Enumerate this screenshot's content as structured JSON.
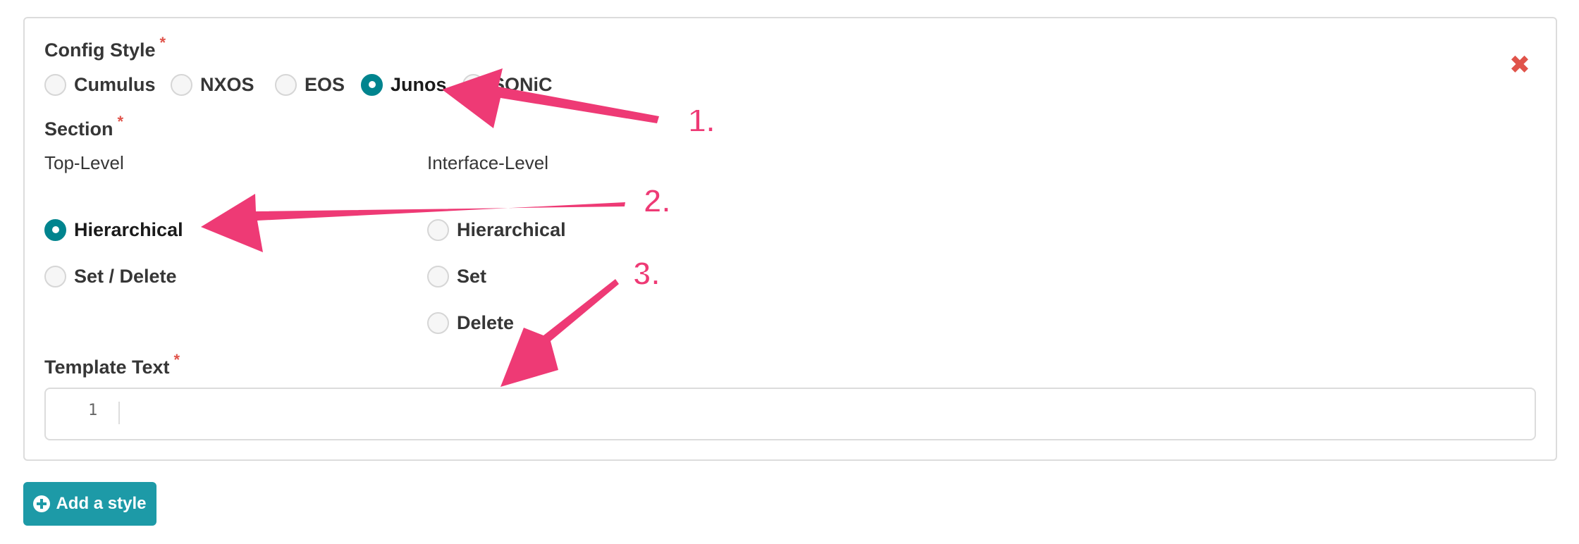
{
  "config_style": {
    "label": "Config Style",
    "required_mark": "*",
    "options": [
      {
        "label": "Cumulus",
        "checked": false
      },
      {
        "label": "NXOS",
        "checked": false
      },
      {
        "label": "EOS",
        "checked": false
      },
      {
        "label": "Junos",
        "checked": true
      },
      {
        "label": "SONiC",
        "checked": false
      }
    ]
  },
  "section": {
    "label": "Section",
    "required_mark": "*",
    "top_level": {
      "label": "Top-Level",
      "options": [
        {
          "label": "Hierarchical",
          "checked": true
        },
        {
          "label": "Set / Delete",
          "checked": false
        }
      ]
    },
    "interface_level": {
      "label": "Interface-Level",
      "options": [
        {
          "label": "Hierarchical",
          "checked": false
        },
        {
          "label": "Set",
          "checked": false
        },
        {
          "label": "Delete",
          "checked": false
        }
      ]
    }
  },
  "template_text": {
    "label": "Template Text",
    "required_mark": "*",
    "line_number": "1",
    "value": ""
  },
  "close_icon": "close-icon",
  "add_style": {
    "label": "Add a style",
    "icon": "plus-circle-icon"
  },
  "annotations": {
    "color": "#ee3a75",
    "steps": [
      "1.",
      "2.",
      "3."
    ]
  }
}
